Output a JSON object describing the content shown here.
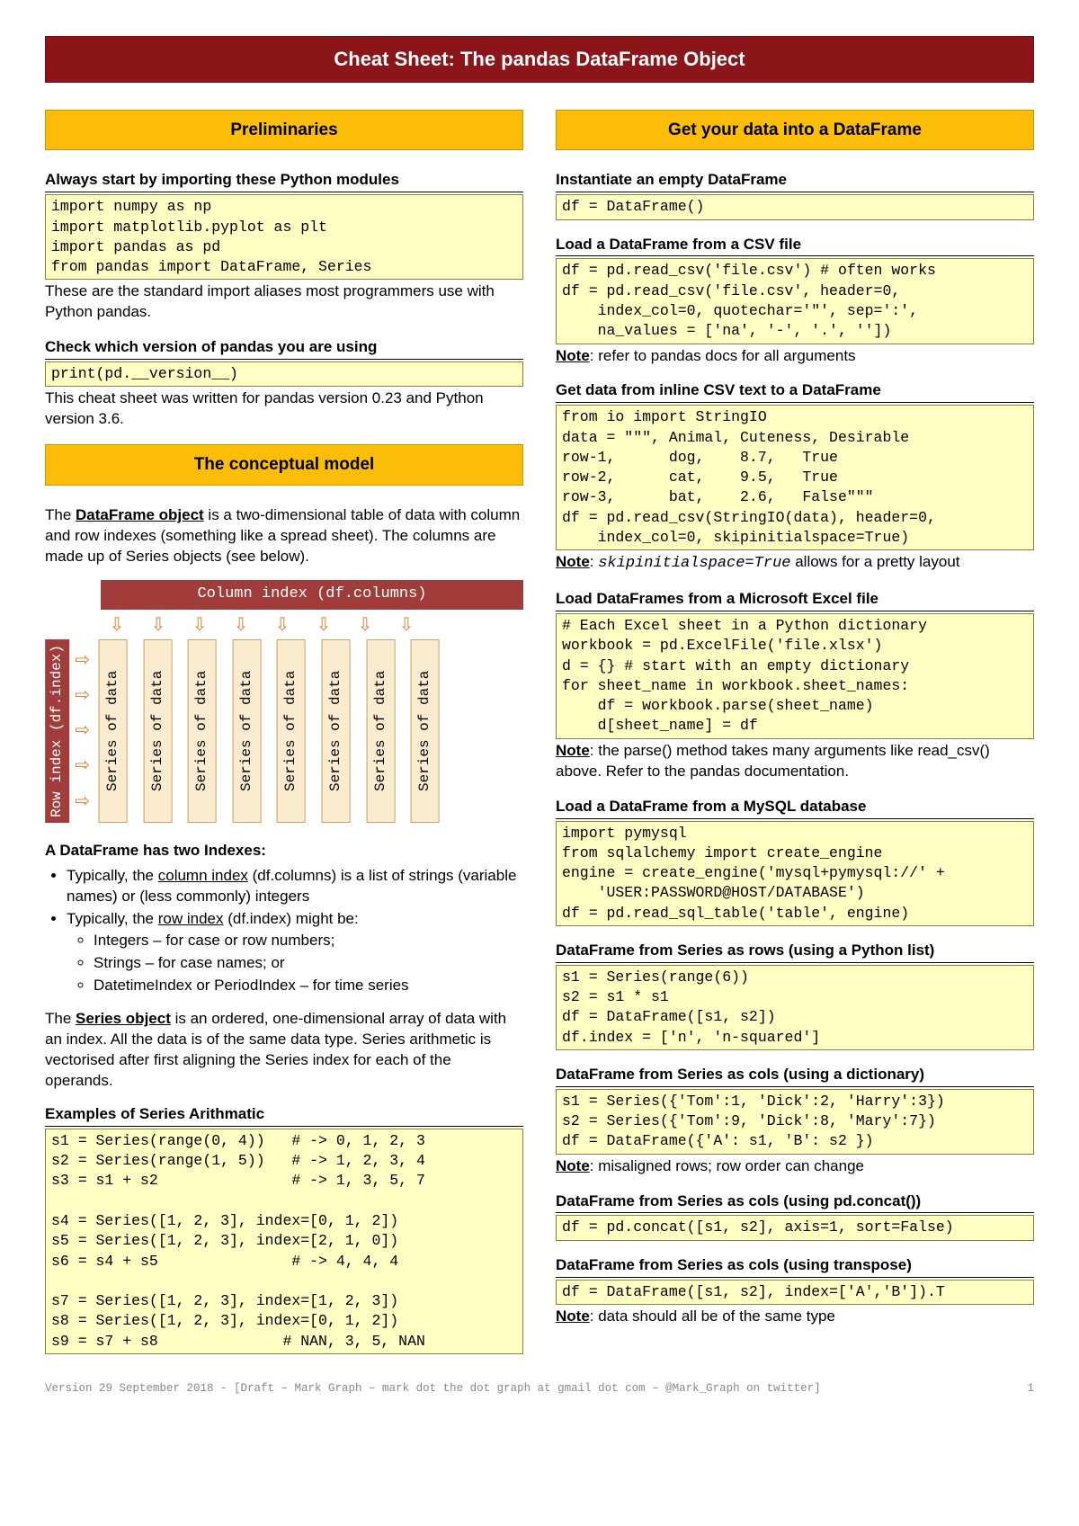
{
  "title": "Cheat Sheet: The pandas DataFrame Object",
  "left": {
    "sec1": "Preliminaries",
    "sub1": "Always start by importing these Python modules",
    "code1": "import numpy as np\nimport matplotlib.pyplot as plt\nimport pandas as pd\nfrom pandas import DataFrame, Series",
    "para1": "These are the standard import aliases most programmers use with Python pandas.",
    "sub2": "Check which version of pandas you are using",
    "code2": "print(pd.__version__)",
    "para2": "This cheat sheet was written for pandas version 0.23 and Python version 3.6.",
    "sec2": "The conceptual model",
    "para3a": "The ",
    "para3b": "DataFrame object",
    "para3c": " is a two-dimensional table of data with column and row indexes (something like a spread sheet). The columns are made up of Series objects (see below).",
    "diag_col_label": "Column index (df.columns)",
    "diag_row_label": "Row index\n(df.index)",
    "diag_series": "Series of data",
    "sub3": "A DataFrame has two Indexes:",
    "bul1a": "Typically, the ",
    "bul1b": "column index",
    "bul1c": " (df.columns) is a list of strings (variable names) or (less commonly) integers",
    "bul2a": "Typically, the ",
    "bul2b": "row index",
    "bul2c": " (df.index) might be:",
    "bul2_1": "Integers – for case or row numbers;",
    "bul2_2": "Strings – for case names; or",
    "bul2_3": "DatetimeIndex or PeriodIndex – for time series",
    "para4a": "The ",
    "para4b": "Series object",
    "para4c": " is an ordered, one-dimensional array of data with an index. All the data is of the same data type. Series arithmetic is vectorised after first aligning the Series index for each of the operands.",
    "sub4": "Examples of Series Arithmatic",
    "code3": "s1 = Series(range(0, 4))   # -> 0, 1, 2, 3\ns2 = Series(range(1, 5))   # -> 1, 2, 3, 4\ns3 = s1 + s2               # -> 1, 3, 5, 7\n\ns4 = Series([1, 2, 3], index=[0, 1, 2])\ns5 = Series([1, 2, 3], index=[2, 1, 0])\ns6 = s4 + s5               # -> 4, 4, 4\n\ns7 = Series([1, 2, 3], index=[1, 2, 3])\ns8 = Series([1, 2, 3], index=[0, 1, 2])\ns9 = s7 + s8              # NAN, 3, 5, NAN"
  },
  "right": {
    "sec1": "Get your data into a DataFrame",
    "sub1": "Instantiate an empty DataFrame",
    "code1": "df = DataFrame()",
    "sub2": "Load a DataFrame from a CSV file",
    "code2": "df = pd.read_csv('file.csv') # often works\ndf = pd.read_csv('file.csv', header=0,\n    index_col=0, quotechar='\"', sep=':',\n    na_values = ['na', '-', '.', ''])",
    "note2a": "Note",
    "note2b": ": refer to pandas docs for all arguments",
    "sub3": "Get data from inline CSV text to a DataFrame",
    "code3": "from io import StringIO\ndata = \"\"\", Animal, Cuteness, Desirable\nrow-1,      dog,    8.7,   True\nrow-2,      cat,    9.5,   True\nrow-3,      bat,    2.6,   False\"\"\"\ndf = pd.read_csv(StringIO(data), header=0,\n    index_col=0, skipinitialspace=True)",
    "note3a": "Note",
    "note3b": ": ",
    "note3c": "skipinitialspace=True",
    "note3d": " allows for a pretty layout",
    "sub4": "Load DataFrames from a Microsoft Excel file",
    "code4": "# Each Excel sheet in a Python dictionary\nworkbook = pd.ExcelFile('file.xlsx')\nd = {} # start with an empty dictionary\nfor sheet_name in workbook.sheet_names:\n    df = workbook.parse(sheet_name)\n    d[sheet_name] = df",
    "note4a": "Note",
    "note4b": ": the parse() method takes many arguments like read_csv() above. Refer to the pandas documentation.",
    "sub5": "Load a DataFrame from a MySQL database",
    "code5": "import pymysql\nfrom sqlalchemy import create_engine\nengine = create_engine('mysql+pymysql://' +\n    'USER:PASSWORD@HOST/DATABASE')\ndf = pd.read_sql_table('table', engine)",
    "sub6": "DataFrame from Series as rows (using a Python list)",
    "code6": "s1 = Series(range(6))\ns2 = s1 * s1\ndf = DataFrame([s1, s2])\ndf.index = ['n', 'n-squared']",
    "sub7": "DataFrame from Series as cols (using a dictionary)",
    "code7": "s1 = Series({'Tom':1, 'Dick':2, 'Harry':3})\ns2 = Series({'Tom':9, 'Dick':8, 'Mary':7})\ndf = DataFrame({'A': s1, 'B': s2 })",
    "note7a": "Note",
    "note7b": ": misaligned rows; row order can change",
    "sub8": "DataFrame from Series as cols (using pd.concat())",
    "code8": "df = pd.concat([s1, s2], axis=1, sort=False)",
    "sub9": "DataFrame from Series as cols (using transpose)",
    "code9": "df = DataFrame([s1, s2], index=['A','B']).T",
    "note9a": "Note",
    "note9b": ": data should all be of the same type"
  },
  "footer_left": "Version 29 September 2018 - [Draft – Mark Graph – mark dot the dot graph at gmail dot com – @Mark_Graph on twitter]",
  "footer_right": "1"
}
